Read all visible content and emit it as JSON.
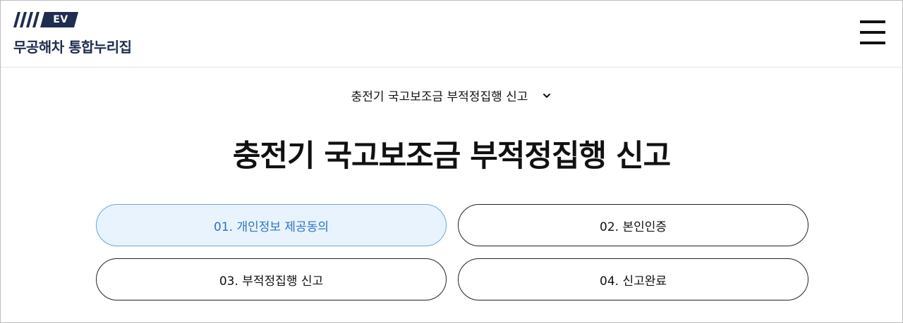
{
  "header": {
    "logo_badge": "EV",
    "logo_title": "무공해차 통합누리집",
    "menu_icon": "hamburger-menu-icon"
  },
  "breadcrumb": {
    "label": "충전기 국고보조금 부적정집행 신고",
    "icon": "chevron-down-icon"
  },
  "page_title": "충전기 국고보조금 부적정집행 신고",
  "steps": [
    {
      "label": "01. 개인정보 제공동의",
      "active": true
    },
    {
      "label": "02. 본인인증",
      "active": false
    },
    {
      "label": "03. 부적정집행 신고",
      "active": false
    },
    {
      "label": "04. 신고완료",
      "active": false
    }
  ],
  "colors": {
    "brand_navy": "#1f2d4f",
    "active_bg": "#e8f3fd",
    "active_border": "#6aa6e0",
    "active_text": "#2f73c2"
  }
}
